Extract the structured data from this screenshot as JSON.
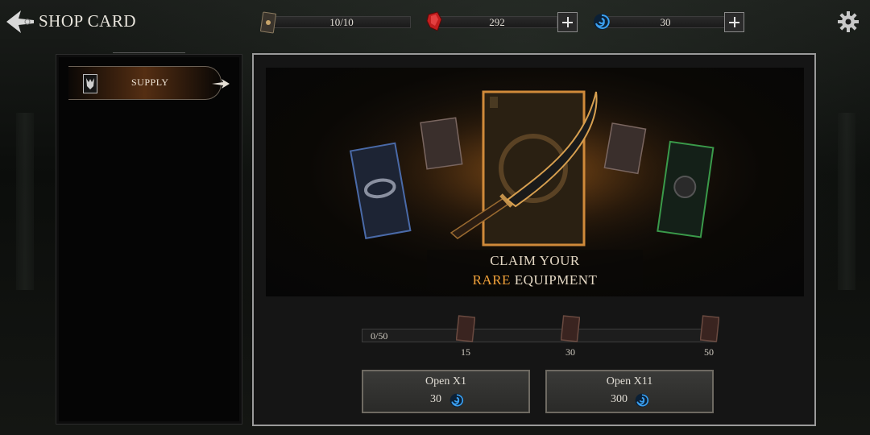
{
  "header": {
    "title": "SHOP CARD"
  },
  "resources": {
    "cards": {
      "value": "10/10",
      "icon": "card-deck-icon"
    },
    "blood": {
      "value": "292",
      "icon": "blood-gem-icon",
      "color": "#c21e1e"
    },
    "soul": {
      "value": "30",
      "icon": "blue-swirl-icon",
      "color": "#2a8adf"
    }
  },
  "sidebar": {
    "items": [
      {
        "label": "SUPPLY",
        "icon": "demon-mask-icon",
        "selected": true
      }
    ]
  },
  "banner": {
    "line1": "CLAIM YOUR",
    "highlight": "RARE",
    "rest": " EQUIPMENT",
    "highlight_color": "#f2a23a"
  },
  "progress": {
    "text": "0/50",
    "current": 0,
    "max": 50,
    "milestones": [
      "15",
      "30",
      "50"
    ]
  },
  "actions": {
    "open1": {
      "label": "Open X1",
      "cost": "30"
    },
    "open11": {
      "label": "Open X11",
      "cost": "300"
    }
  }
}
